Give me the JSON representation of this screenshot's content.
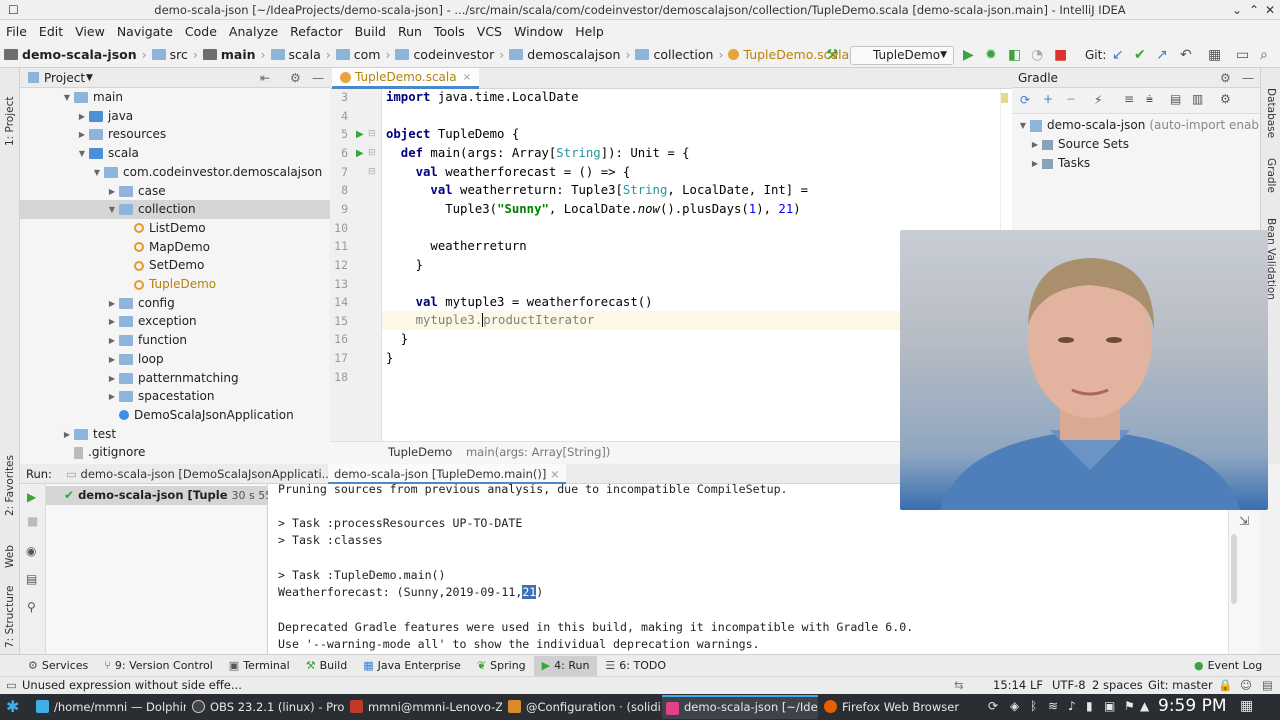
{
  "window": {
    "title": "demo-scala-json [~/IdeaProjects/demo-scala-json] - .../src/main/scala/com/codeinvestor/demoscalajson/collection/TupleDemo.scala [demo-scala-json.main] - IntelliJ IDEA"
  },
  "menu": [
    "File",
    "Edit",
    "View",
    "Navigate",
    "Code",
    "Analyze",
    "Refactor",
    "Build",
    "Run",
    "Tools",
    "VCS",
    "Window",
    "Help"
  ],
  "breadcrumb": [
    "demo-scala-json",
    "src",
    "main",
    "scala",
    "com",
    "codeinvestor",
    "demoscalajson",
    "collection",
    "TupleDemo.scala"
  ],
  "run_config": "TupleDemo",
  "git_label": "Git:",
  "project_panel": {
    "title": "Project"
  },
  "tree": [
    {
      "label": "main",
      "indent": 2,
      "arrow": "down",
      "icon": "folder"
    },
    {
      "label": "java",
      "indent": 3,
      "arrow": "right",
      "icon": "folder-blue"
    },
    {
      "label": "resources",
      "indent": 3,
      "arrow": "right",
      "icon": "folder"
    },
    {
      "label": "scala",
      "indent": 3,
      "arrow": "down",
      "icon": "folder-blue"
    },
    {
      "label": "com.codeinvestor.demoscalajson",
      "indent": 4,
      "arrow": "down",
      "icon": "folder"
    },
    {
      "label": "case",
      "indent": 5,
      "arrow": "right",
      "icon": "folder"
    },
    {
      "label": "collection",
      "indent": 5,
      "arrow": "down",
      "icon": "folder",
      "selected": true
    },
    {
      "label": "ListDemo",
      "indent": 6,
      "arrow": "",
      "icon": "object"
    },
    {
      "label": "MapDemo",
      "indent": 6,
      "arrow": "",
      "icon": "object"
    },
    {
      "label": "SetDemo",
      "indent": 6,
      "arrow": "",
      "icon": "object"
    },
    {
      "label": "TupleDemo",
      "indent": 6,
      "arrow": "",
      "icon": "object",
      "modified": true
    },
    {
      "label": "config",
      "indent": 5,
      "arrow": "right",
      "icon": "folder"
    },
    {
      "label": "exception",
      "indent": 5,
      "arrow": "right",
      "icon": "folder"
    },
    {
      "label": "function",
      "indent": 5,
      "arrow": "right",
      "icon": "folder"
    },
    {
      "label": "loop",
      "indent": 5,
      "arrow": "right",
      "icon": "folder"
    },
    {
      "label": "patternmatching",
      "indent": 5,
      "arrow": "right",
      "icon": "folder"
    },
    {
      "label": "spacestation",
      "indent": 5,
      "arrow": "right",
      "icon": "folder"
    },
    {
      "label": "DemoScalaJsonApplication",
      "indent": 5,
      "arrow": "",
      "icon": "class"
    },
    {
      "label": "test",
      "indent": 2,
      "arrow": "right",
      "icon": "folder"
    },
    {
      "label": ".gitignore",
      "indent": 2,
      "arrow": "",
      "icon": "file"
    }
  ],
  "editor": {
    "tab": "TupleDemo.scala",
    "line_numbers": [
      "3",
      "4",
      "5",
      "6",
      "7",
      "8",
      "9",
      "10",
      "11",
      "12",
      "13",
      "14",
      "15",
      "16",
      "17",
      "18"
    ],
    "code": {
      "l3a": "import ",
      "l3b": "java.time.LocalDate",
      "l5a": "object ",
      "l5b": "TupleDemo {",
      "l6a": "  def ",
      "l6b": "main(args: Array[",
      "l6c": "String",
      "l6d": "]): Unit = {",
      "l7a": "    val ",
      "l7b": "weatherforecast = () => {",
      "l8a": "      val ",
      "l8b": "weatherreturn: Tuple3[",
      "l8c": "String",
      "l8d": ", LocalDate, Int] =",
      "l9a": "        Tuple3(",
      "l9b": "\"Sunny\"",
      "l9c": ", LocalDate.",
      "l9d": "now",
      "l9e": "().plusDays(",
      "l9f": "1",
      "l9g": "), ",
      "l9h": "21",
      "l9i": ")",
      "l11": "      weatherreturn",
      "l12": "    }",
      "l14a": "    val ",
      "l14b": "mytuple3 = weatherforecast()",
      "l15a": "    mytuple3.",
      "l15b": "productIterator",
      "l16": "  }",
      "l17": "}"
    },
    "breadcrumb": [
      "TupleDemo",
      "main(args: Array[String])"
    ]
  },
  "gradle": {
    "title": "Gradle",
    "project": "demo-scala-json",
    "project_note": "(auto-import enabled)",
    "items": [
      "Source Sets",
      "Tasks"
    ]
  },
  "right_strip": [
    "Database",
    "Gradle",
    "Bean Validation"
  ],
  "left_strip": [
    "1: Project",
    "2: Favorites",
    "Web",
    "7: Structure"
  ],
  "run": {
    "label": "Run:",
    "tabs": [
      "demo-scala-json [DemoScalaJsonApplicati...",
      "demo-scala-json [TupleDemo.main()]"
    ],
    "tree_item": "demo-scala-json [Tuple",
    "tree_time": "30 s 557 ms",
    "console": [
      "Pruning sources from previous analysis, due to incompatible CompileSetup.",
      "",
      "> Task :processResources UP-TO-DATE",
      "> Task :classes",
      "",
      "> Task :TupleDemo.main()",
      "Weatherforecast: (Sunny,2019-09-11,",
      "",
      "Deprecated Gradle features were used in this build, making it incompatible with Gradle 6.0.",
      "Use '--warning-mode all' to show the individual deprecation warnings."
    ],
    "console_sel": "21",
    "console_end": ")"
  },
  "toolwindows": [
    "Services",
    "9: Version Control",
    "Terminal",
    "Build",
    "Java Enterprise",
    "Spring",
    "4: Run",
    "6: TODO"
  ],
  "event_log": "Event Log",
  "status": {
    "message": "Unused expression without side effe...",
    "position": "15:14",
    "line_sep": "LF",
    "encoding": "UTF-8",
    "indent": "2 spaces",
    "vcs": "Git: master"
  },
  "taskbar": {
    "tasks": [
      "/home/mmni — Dolphin",
      "OBS 23.2.1 (linux) - Profile...",
      "mmni@mmni-Lenovo-Z7...",
      "@Configuration · (solidity...",
      "demo-scala-json [~/IdeaP...",
      "Firefox Web Browser"
    ],
    "clock": "9:59 PM"
  },
  "colors": {
    "accent": "#4a88c7",
    "selection": "#d5d5d5",
    "taskbar": "#2a2e32",
    "kde": "#3daee9"
  }
}
